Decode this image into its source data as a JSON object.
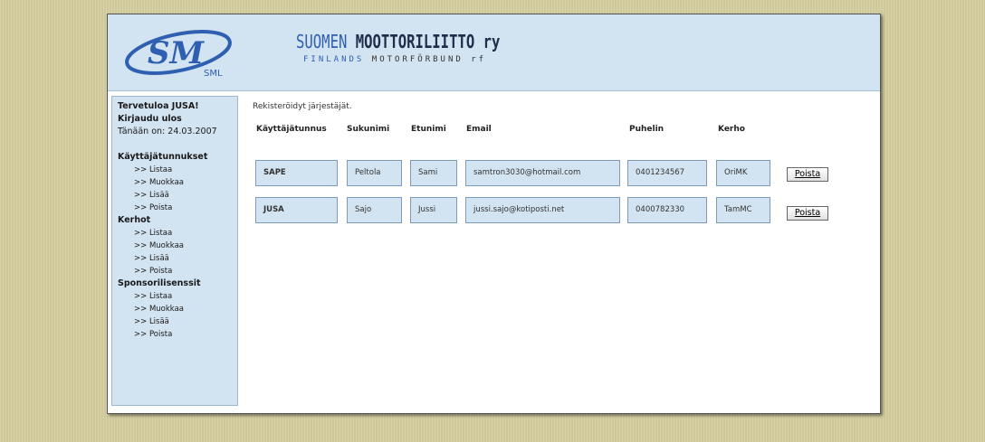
{
  "header": {
    "logo_text": "SML",
    "title_part1": "SUOMEN",
    "title_part2": "MOOTTORILIITTO",
    "title_suffix": "ry",
    "subtitle_part1": "FINLANDS",
    "subtitle_part2": "MOTORFÖRBUND",
    "subtitle_suffix": "rf"
  },
  "sidebar": {
    "welcome": "Tervetuloa JUSA!",
    "logout": "Kirjaudu ulos",
    "today": "Tänään on: 24.03.2007",
    "sections": [
      {
        "title": "Käyttäjätunnukset",
        "links": [
          ">> Listaa",
          ">> Muokkaa",
          ">> Lisää",
          ">> Poista"
        ]
      },
      {
        "title": "Kerhot",
        "links": [
          ">> Listaa",
          ">> Muokkaa",
          ">> Lisää",
          ">> Poista"
        ]
      },
      {
        "title": "Sponsorilisenssit",
        "links": [
          ">> Listaa",
          ">> Muokkaa",
          ">> Lisää",
          ">> Poista"
        ]
      }
    ]
  },
  "main": {
    "caption": "Rekisteröidyt järjestäjät.",
    "columns": [
      "Käyttäjätunnus",
      "Sukunimi",
      "Etunimi",
      "Email",
      "Puhelin",
      "Kerho"
    ],
    "rows": [
      {
        "username": "SAPE",
        "lastname": "Peltola",
        "firstname": "Sami",
        "email": "samtron3030@hotmail.com",
        "phone": "0401234567",
        "club": "OriMK",
        "delete_label": "Poista"
      },
      {
        "username": "JUSA",
        "lastname": "Sajo",
        "firstname": "Jussi",
        "email": "jussi.sajo@kotiposti.net",
        "phone": "0400782330",
        "club": "TamMC",
        "delete_label": "Poista"
      }
    ]
  },
  "colors": {
    "background": "#cfc99a",
    "panel": "#d2e3f1",
    "border": "#7d9bbb",
    "logo_blue": "#2f5fb0"
  }
}
